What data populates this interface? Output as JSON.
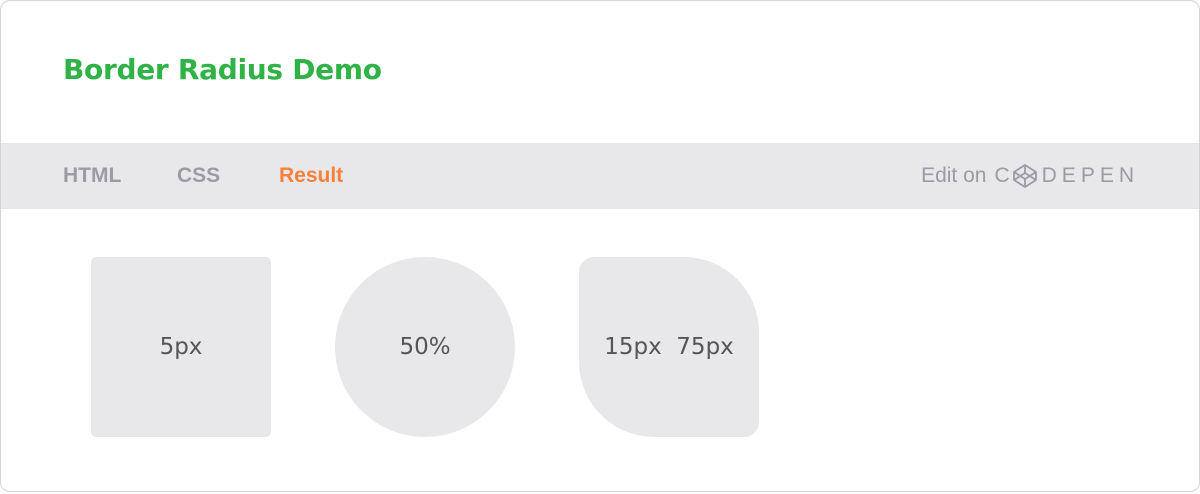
{
  "title": "Border Radius Demo",
  "tabs": [
    {
      "label": "HTML",
      "active": false
    },
    {
      "label": "CSS",
      "active": false
    },
    {
      "label": "Result",
      "active": true
    }
  ],
  "edit_link": {
    "text": "Edit on",
    "brand_first": "C",
    "brand_rest": "DEPEN",
    "icon": "codepen-cube-icon"
  },
  "shapes": [
    {
      "label": "5px"
    },
    {
      "label": "50%"
    },
    {
      "label": "15px  75px"
    }
  ],
  "colors": {
    "title": "#2fb347",
    "active_tab": "#f5813a",
    "inactive_tab": "#9b9ba6",
    "tabbar_bg": "#e8e8ea",
    "shape_bg": "#e8e8ea",
    "shape_text": "#555558"
  }
}
